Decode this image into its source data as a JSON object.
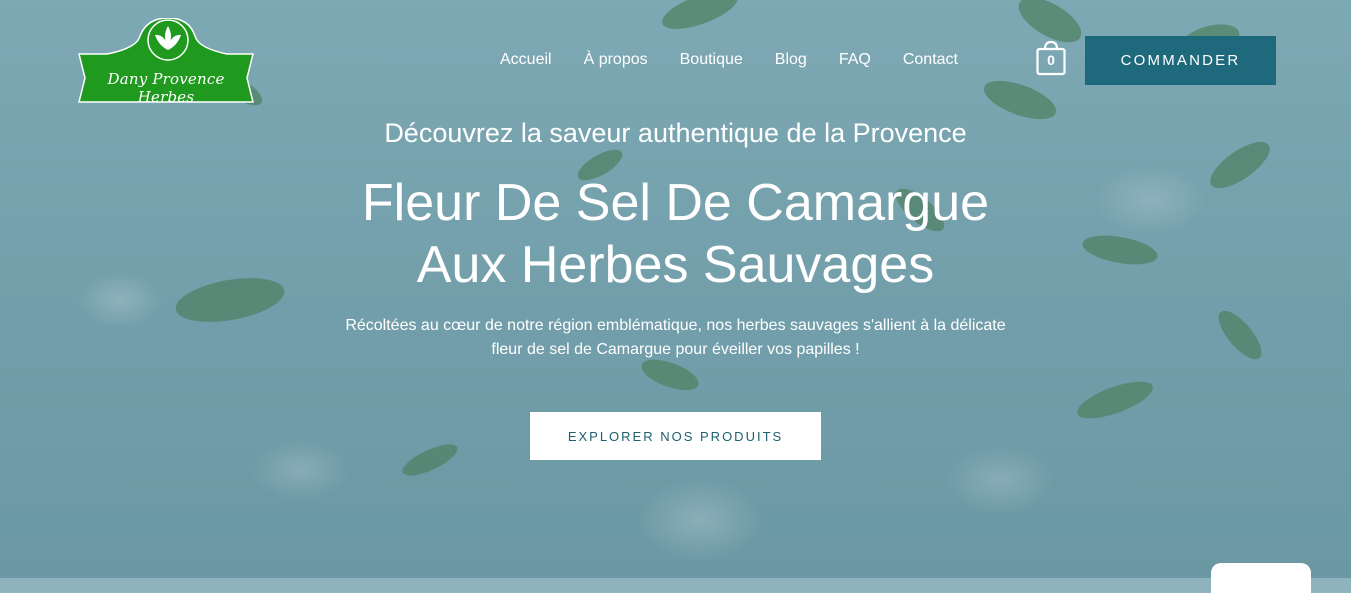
{
  "logo": {
    "text": "Dany Provence Herbes",
    "icon": "leaf-sprout-icon",
    "color": "#1f9a1f"
  },
  "nav": {
    "items": [
      "Accueil",
      "À propos",
      "Boutique",
      "Blog",
      "FAQ",
      "Contact"
    ]
  },
  "cart": {
    "icon": "shopping-bag-icon",
    "count": "0"
  },
  "cta": {
    "label": "COMMANDER",
    "color": "#1e6a7c"
  },
  "hero": {
    "subtitle": "Découvrez la saveur authentique de la Provence",
    "title_line1": "Fleur De Sel De Camargue",
    "title_line2": "Aux Herbes Sauvages",
    "description": "Récoltées au cœur de notre région emblématique, nos herbes sauvages s'allient à la délicate fleur de sel de Camargue pour éveiller vos papilles !",
    "button_label": "EXPLORER NOS PRODUITS"
  },
  "colors": {
    "accent": "#1e6a7c",
    "text": "#ffffff"
  }
}
